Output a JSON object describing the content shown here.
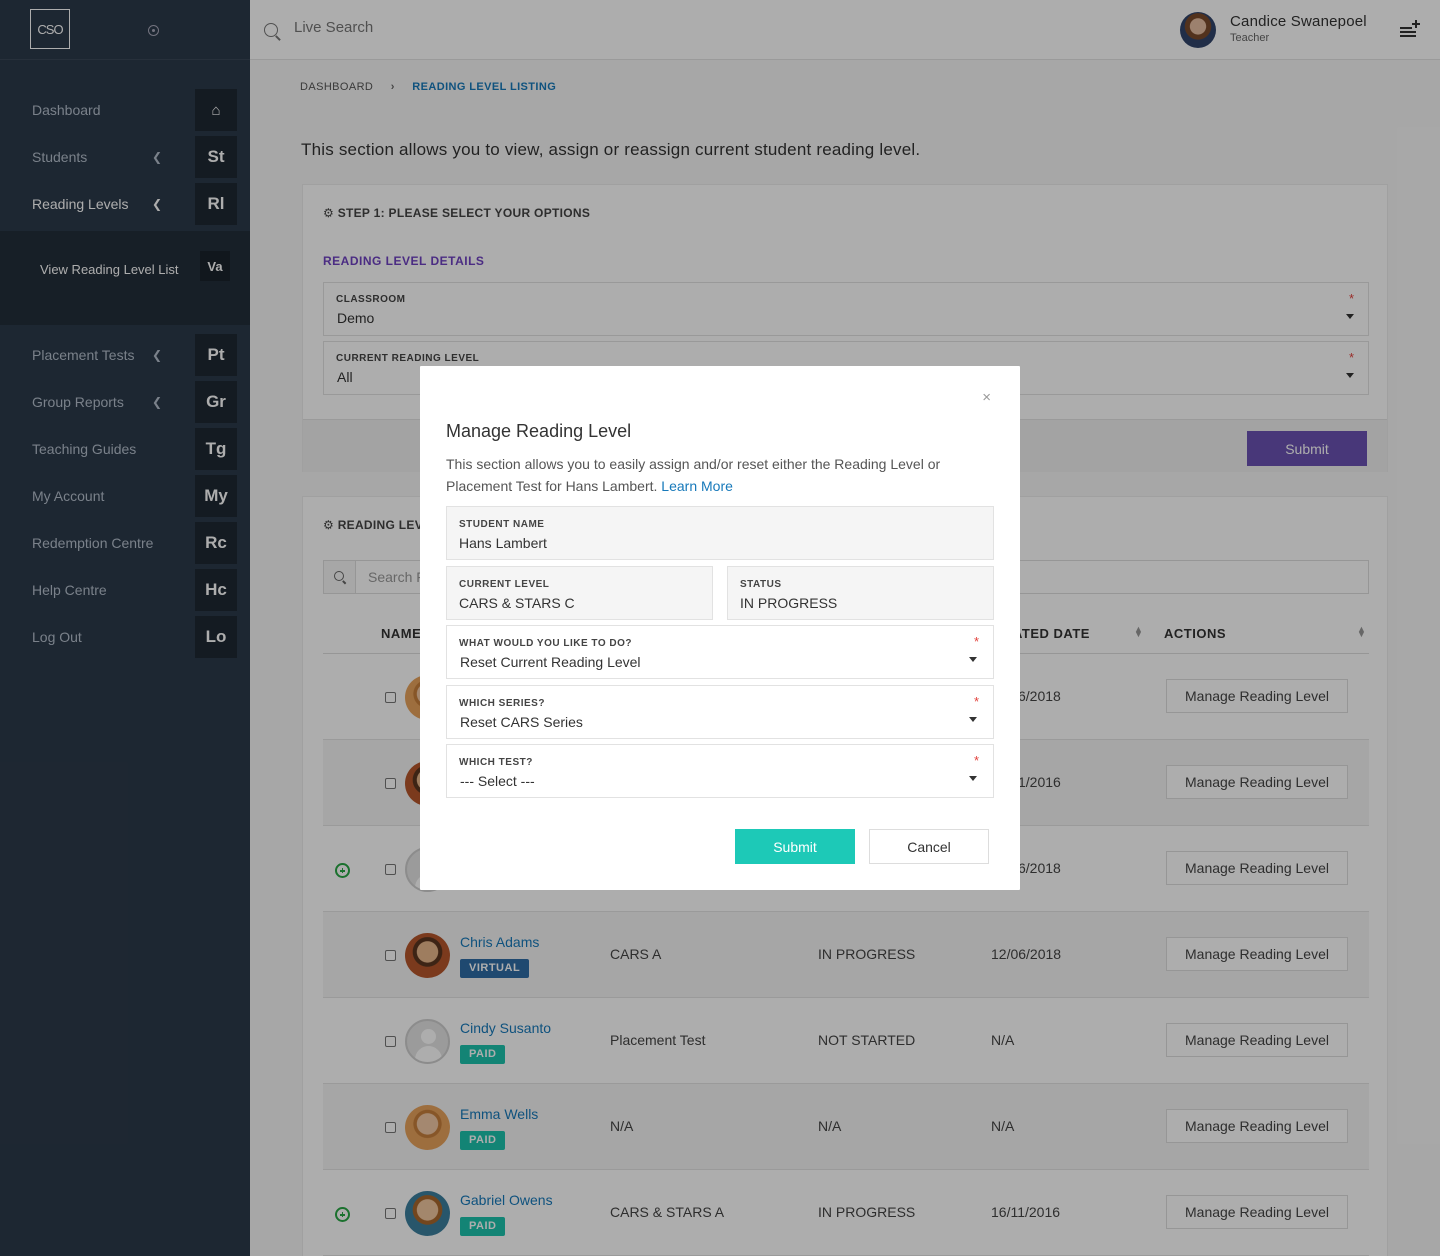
{
  "sidebar": {
    "logo": "CSO",
    "items": [
      {
        "label": "Dashboard",
        "abbr": "⌂",
        "icon": "home-icon"
      },
      {
        "label": "Students",
        "abbr": "St"
      },
      {
        "label": "Reading Levels",
        "abbr": "Rl"
      },
      {
        "label": "Placement Tests",
        "abbr": "Pt"
      },
      {
        "label": "Group Reports",
        "abbr": "Gr"
      },
      {
        "label": "Teaching Guides",
        "abbr": "Tg"
      },
      {
        "label": "My Account",
        "abbr": "My"
      },
      {
        "label": "Redemption Centre",
        "abbr": "Rc"
      },
      {
        "label": "Help Centre",
        "abbr": "Hc"
      },
      {
        "label": "Log Out",
        "abbr": "Lo"
      }
    ],
    "subitem": {
      "label": "View Reading Level List",
      "abbr": "Va"
    }
  },
  "header": {
    "search_placeholder": "Live Search",
    "user_name": "Candice Swanepoel",
    "user_role": "Teacher"
  },
  "breadcrumb": {
    "item1": "DASHBOARD",
    "separator": "›",
    "item2": "READING LEVEL LISTING"
  },
  "intro": "This section allows you to view, assign or reassign current student reading level.",
  "step1": {
    "title": "⚙ STEP 1: PLEASE SELECT YOUR OPTIONS",
    "section_title": "READING LEVEL DETAILS",
    "classroom_label": "CLASSROOM",
    "classroom_value": "Demo",
    "level_label": "CURRENT READING LEVEL",
    "level_value": "All",
    "required_mark": "*",
    "submit": "Submit"
  },
  "listing": {
    "title": "⚙ READING LEV",
    "search_placeholder": "Search F",
    "headers": {
      "name": "NAME",
      "date": "ATED DATE",
      "actions": "ACTIONS"
    },
    "rows": [
      {
        "name": "",
        "badge": "",
        "level": "",
        "status": "",
        "date": "6/2018",
        "action": "Manage Reading Level"
      },
      {
        "name": "",
        "badge": "",
        "level": "",
        "status": "",
        "date": "1/2016",
        "action": "Manage Reading Level"
      },
      {
        "name": "",
        "badge": "",
        "level": "",
        "status": "",
        "date": "6/2018",
        "action": "Manage Reading Level"
      },
      {
        "name": "Chris Adams",
        "badge": "VIRTUAL",
        "level": "CARS A",
        "status": "IN PROGRESS",
        "date": "12/06/2018",
        "action": "Manage Reading Level"
      },
      {
        "name": "Cindy Susanto",
        "badge": "PAID",
        "level": "Placement Test",
        "status": "NOT STARTED",
        "date": "N/A",
        "action": "Manage Reading Level"
      },
      {
        "name": "Emma Wells",
        "badge": "PAID",
        "level": "N/A",
        "status": "N/A",
        "date": "N/A",
        "action": "Manage Reading Level"
      },
      {
        "name": "Gabriel Owens",
        "badge": "PAID",
        "level": "CARS & STARS A",
        "status": "IN PROGRESS",
        "date": "16/11/2016",
        "action": "Manage Reading Level"
      }
    ]
  },
  "modal": {
    "close": "×",
    "title": "Manage Reading Level",
    "description": "This section allows you to easily assign and/or reset either the Reading Level or Placement Test for Hans Lambert.",
    "learn_more": "Learn More",
    "student_name_label": "STUDENT NAME",
    "student_name": "Hans Lambert",
    "current_level_label": "CURRENT LEVEL",
    "current_level": "CARS & STARS C",
    "status_label": "STATUS",
    "status": "IN PROGRESS",
    "action_label": "WHAT WOULD YOU LIKE TO DO?",
    "action_value": "Reset Current Reading Level",
    "series_label": "WHICH SERIES?",
    "series_value": "Reset CARS Series",
    "test_label": "WHICH TEST?",
    "test_value": "--- Select ---",
    "required_mark": "*",
    "submit": "Submit",
    "cancel": "Cancel"
  },
  "colors": {
    "sidebar_bg": "#2c3a4a",
    "accent_purple": "#6a52b3",
    "accent_teal": "#1dc9b7",
    "link_blue": "#1779ba",
    "badge_paid": "#1cc3ad",
    "badge_virtual": "#2f6ca5"
  }
}
